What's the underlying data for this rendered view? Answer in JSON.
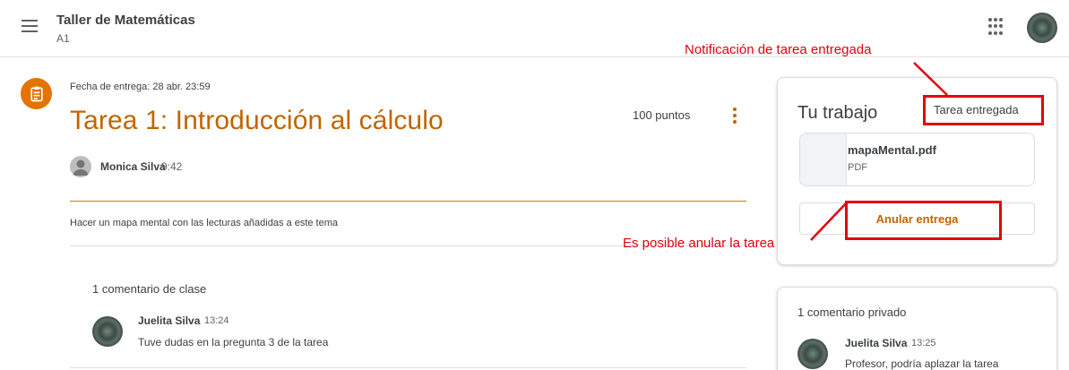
{
  "header": {
    "course_title": "Taller de Matemáticas",
    "course_section": "A1",
    "menu_icon": "hamburger-menu-icon",
    "apps_icon": "apps-grid-icon"
  },
  "assignment": {
    "icon": "assignment-clipboard-icon",
    "due": "Fecha de entrega: 28 abr. 23:59",
    "title": "Tarea 1: Introducción al cálculo",
    "points": "100 puntos",
    "author": "Monica Silva",
    "time": "9:42",
    "description": "Hacer un mapa mental con las lecturas añadidas a este tema"
  },
  "class_comments": {
    "heading": "1 comentario de clase",
    "items": [
      {
        "author": "Juelita Silva",
        "time": "13:24",
        "text": "Tuve dudas en la pregunta 3 de la tarea"
      }
    ]
  },
  "your_work": {
    "title": "Tu trabajo",
    "status": "Tarea entregada",
    "file": {
      "name": "mapaMental.pdf",
      "type": "PDF"
    },
    "unsubmit_label": "Anular entrega"
  },
  "private_comments": {
    "heading": "1 comentario privado",
    "items": [
      {
        "author": "Juelita Silva",
        "time": "13:25",
        "text": "Profesor, podría aplazar la tarea"
      }
    ]
  },
  "annotations": {
    "top": "Notificación de tarea entregada",
    "middle": "Es posible anular la tarea"
  },
  "colors": {
    "accent": "#c26401",
    "assignment_icon_bg": "#e37400",
    "annotation_red": "#e3000f"
  }
}
